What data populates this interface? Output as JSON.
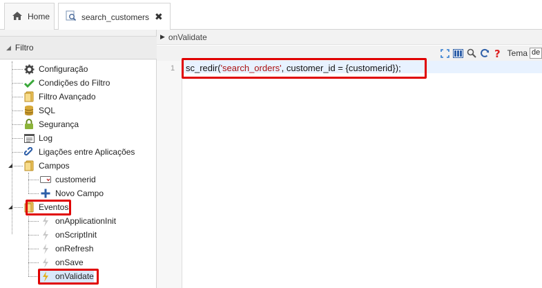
{
  "tabs": {
    "home_label": "Home",
    "active_label": "search_customers",
    "close_glyph": "✖"
  },
  "panel": {
    "title": "Filtro"
  },
  "tree": {
    "items": [
      {
        "label": "Configuração",
        "icon": "gear-icon"
      },
      {
        "label": "Condições do Filtro",
        "icon": "check-icon"
      },
      {
        "label": "Filtro Avançado",
        "icon": "folder-icon"
      },
      {
        "label": "SQL",
        "icon": "database-icon"
      },
      {
        "label": "Segurança",
        "icon": "lock-icon"
      },
      {
        "label": "Log",
        "icon": "log-icon"
      },
      {
        "label": "Ligações entre Aplicações",
        "icon": "link-icon"
      },
      {
        "label": "Campos",
        "icon": "folder-icon"
      },
      {
        "label": "customerid",
        "icon": "field-icon"
      },
      {
        "label": "Novo Campo",
        "icon": "plus-icon"
      },
      {
        "label": "Eventos",
        "icon": "folder-icon"
      },
      {
        "label": "onApplicationInit",
        "icon": "lightning-icon"
      },
      {
        "label": "onScriptInit",
        "icon": "lightning-icon"
      },
      {
        "label": "onRefresh",
        "icon": "lightning-icon"
      },
      {
        "label": "onSave",
        "icon": "lightning-icon"
      },
      {
        "label": "onValidate",
        "icon": "lightning-icon"
      }
    ]
  },
  "main": {
    "breadcrumb": "onValidate",
    "tema_label": "Tema",
    "tema_value": "de",
    "line_number": "1",
    "code_prefix": "sc_redir(",
    "code_string": "'search_orders'",
    "code_suffix": ", customer_id = {customerid});"
  },
  "colors": {
    "highlight": "#e00000",
    "accent_blue": "#2e7bcf",
    "check_green": "#3aa83a"
  }
}
